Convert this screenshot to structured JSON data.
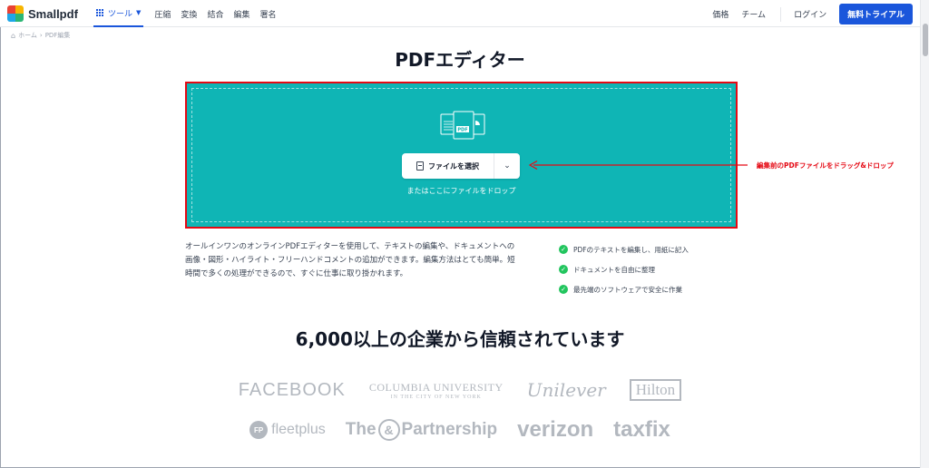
{
  "header": {
    "logo_text": "Smallpdf",
    "nav": {
      "tools_label": "ツール",
      "items": [
        "圧縮",
        "変換",
        "結合",
        "編集",
        "署名"
      ]
    },
    "right": {
      "pricing": "価格",
      "team": "チーム",
      "login": "ログイン",
      "trial": "無料トライアル"
    }
  },
  "breadcrumb": {
    "home": "ホーム",
    "current": "PDF編集"
  },
  "page": {
    "title": "PDFエディター"
  },
  "dropzone": {
    "choose_label": "ファイルを選択",
    "hint": "またはここにファイルをドロップ",
    "file_badge": "PDF",
    "bg_color": "#0fb5b5",
    "highlight_color": "#e50914"
  },
  "annotation": {
    "text": "編集前のPDFファイルをドラッグ&ドロップ"
  },
  "description": {
    "text": "オールインワンのオンラインPDFエディターを使用して、テキストの編集や、ドキュメントへの画像・図形・ハイライト・フリーハンドコメントの追加ができます。編集方法はとても簡単。短時間で多くの処理ができるので、すぐに仕事に取り掛かれます。"
  },
  "features": [
    "PDFのテキストを編集し、用紙に記入",
    "ドキュメントを自由に整理",
    "最先端のソフトウェアで安全に作業"
  ],
  "trust": {
    "title": "6,000以上の企業から信頼されています",
    "logos": {
      "facebook": "FACEBOOK",
      "columbia_main": "COLUMBIA UNIVERSITY",
      "columbia_sub": "IN THE CITY OF NEW YORK",
      "unilever": "Unilever",
      "hilton": "Hilton",
      "fleetplus_badge": "FP",
      "fleetplus": "fleetplus",
      "partnership_pre": "The",
      "partnership_amp": "&",
      "partnership_post": "Partnership",
      "verizon": "verizon",
      "taxfix": "taxfix"
    }
  }
}
